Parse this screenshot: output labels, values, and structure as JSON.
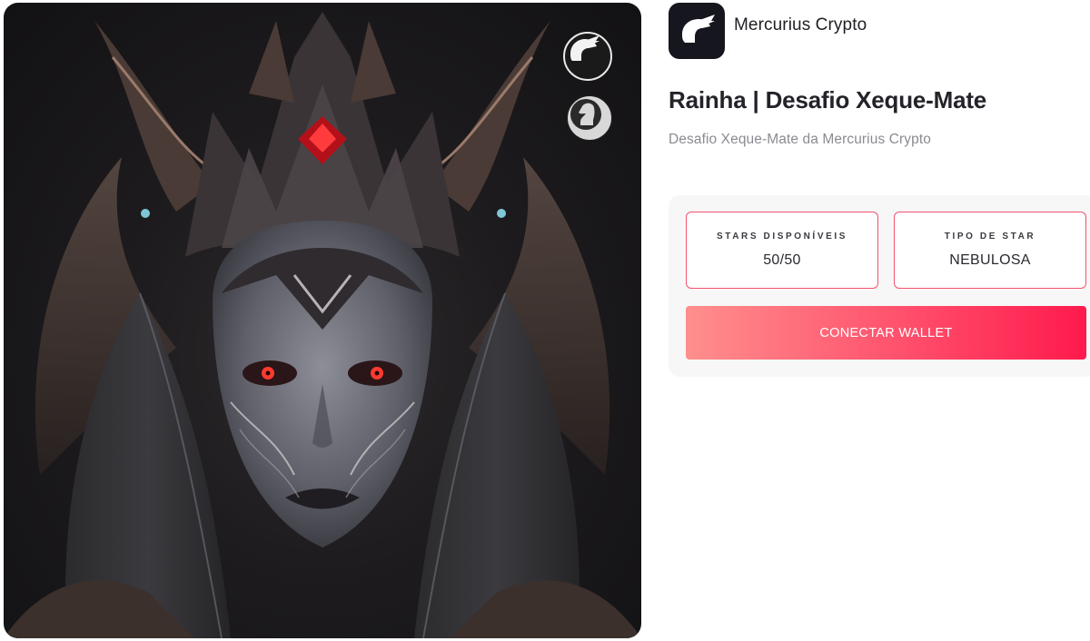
{
  "brand": {
    "name": "Mercurius Crypto",
    "logo_icon": "winged-helmet-icon"
  },
  "product": {
    "title": "Rainha | Desafio Xeque-Mate",
    "subtitle": "Desafio Xeque-Mate da Mercurius Crypto"
  },
  "artwork": {
    "subject": "queen-portrait-image",
    "badges": [
      "winged-helmet-icon",
      "chess-knight-icon"
    ]
  },
  "stats": [
    {
      "label": "STARS DISPONÍVEIS",
      "value": "50/50"
    },
    {
      "label": "TIPO DE STAR",
      "value": "NEBULOSA"
    }
  ],
  "actions": {
    "connect_label": "CONECTAR WALLET"
  },
  "colors": {
    "accent": "#ff1a4c",
    "accent_light": "#ff8f8d",
    "border_accent": "#f3526c",
    "brand_logo_bg": "#16161e"
  }
}
